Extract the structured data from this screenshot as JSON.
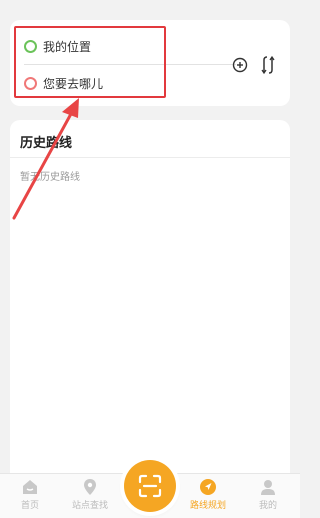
{
  "route": {
    "origin_label": "我的位置",
    "destination_label": "您要去哪儿",
    "add_icon": "plus-circle-icon",
    "swap_icon": "swap-icon"
  },
  "history": {
    "title": "历史路线",
    "empty_text": "暂无历史路线"
  },
  "tabbar": {
    "tabs": [
      {
        "label": "首页",
        "icon": "home-icon"
      },
      {
        "label": "站点查找",
        "icon": "location-pin-icon"
      },
      {
        "label": "路线规划",
        "icon": "navigation-icon",
        "active": true
      },
      {
        "label": "我的",
        "icon": "user-icon"
      }
    ],
    "scan_icon": "scan-icon"
  },
  "colors": {
    "accent": "#f5a623",
    "origin_dot": "#6bc35a",
    "destination_dot": "#f07878",
    "highlight": "#e2393d"
  }
}
